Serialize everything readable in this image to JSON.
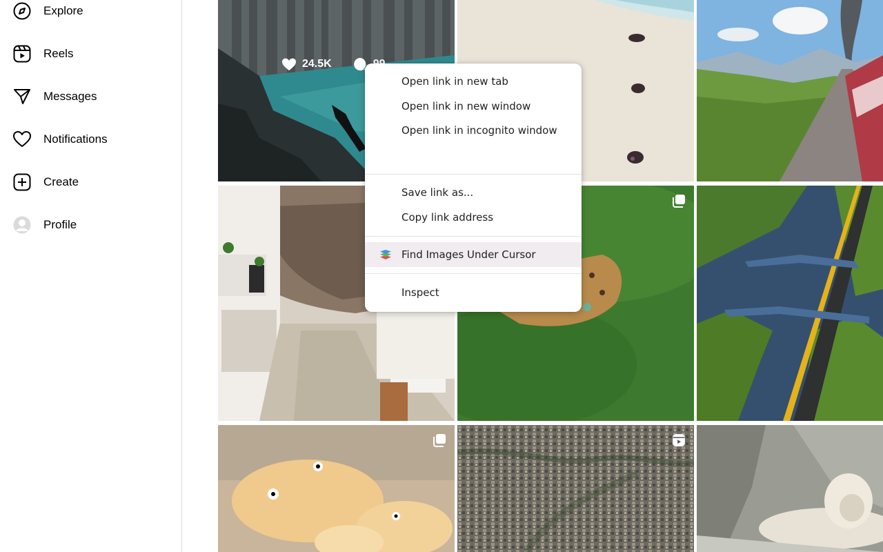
{
  "sidebar": {
    "items": [
      {
        "label": "Explore",
        "icon": "compass-icon"
      },
      {
        "label": "Reels",
        "icon": "reels-icon"
      },
      {
        "label": "Messages",
        "icon": "paper-plane-icon"
      },
      {
        "label": "Notifications",
        "icon": "heart-icon"
      },
      {
        "label": "Create",
        "icon": "plus-square-icon"
      },
      {
        "label": "Profile",
        "icon": "avatar"
      }
    ]
  },
  "grid": {
    "first_post": {
      "likes": "24.5K",
      "comments": "99"
    },
    "tiles": [
      {
        "name": "post-basalt-cliff-swimmer",
        "badge": ""
      },
      {
        "name": "post-beach-turtles",
        "badge": ""
      },
      {
        "name": "post-mountain-train",
        "badge": ""
      },
      {
        "name": "post-cave-village-street",
        "badge": ""
      },
      {
        "name": "post-leopard-in-grass",
        "badge": "carousel-icon"
      },
      {
        "name": "post-aqueduct-highway",
        "badge": ""
      },
      {
        "name": "post-cloud-creatures",
        "badge": "carousel-icon"
      },
      {
        "name": "post-favela-aerial",
        "badge": "reels-icon"
      },
      {
        "name": "post-white-lion",
        "badge": ""
      }
    ]
  },
  "context_menu": {
    "open_new_tab": "Open link in new tab",
    "open_new_window": "Open link in new window",
    "open_incognito": "Open link in incognito window",
    "save_link": "Save link as...",
    "copy_link": "Copy link address",
    "find_images": "Find Images Under Cursor",
    "inspect": "Inspect"
  }
}
